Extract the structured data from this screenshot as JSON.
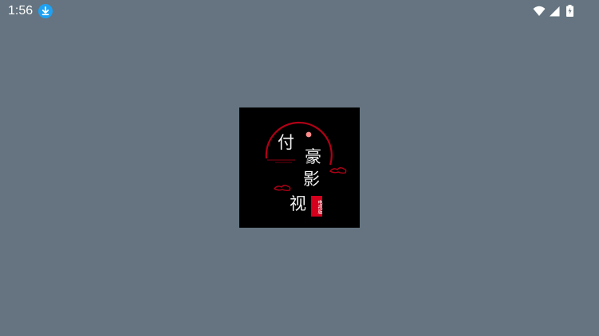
{
  "status_bar": {
    "time": "1:56",
    "icons": [
      "download-icon",
      "wifi-icon",
      "signal-icon",
      "battery-icon"
    ]
  },
  "splash": {
    "logo_chars": [
      "付",
      "豪",
      "影",
      "视"
    ],
    "badge_text": "电视版",
    "colors": {
      "background": "#657480",
      "logo_bg": "#000000",
      "accent_red": "#d4001c",
      "download_badge": "#1ea1f2"
    }
  }
}
